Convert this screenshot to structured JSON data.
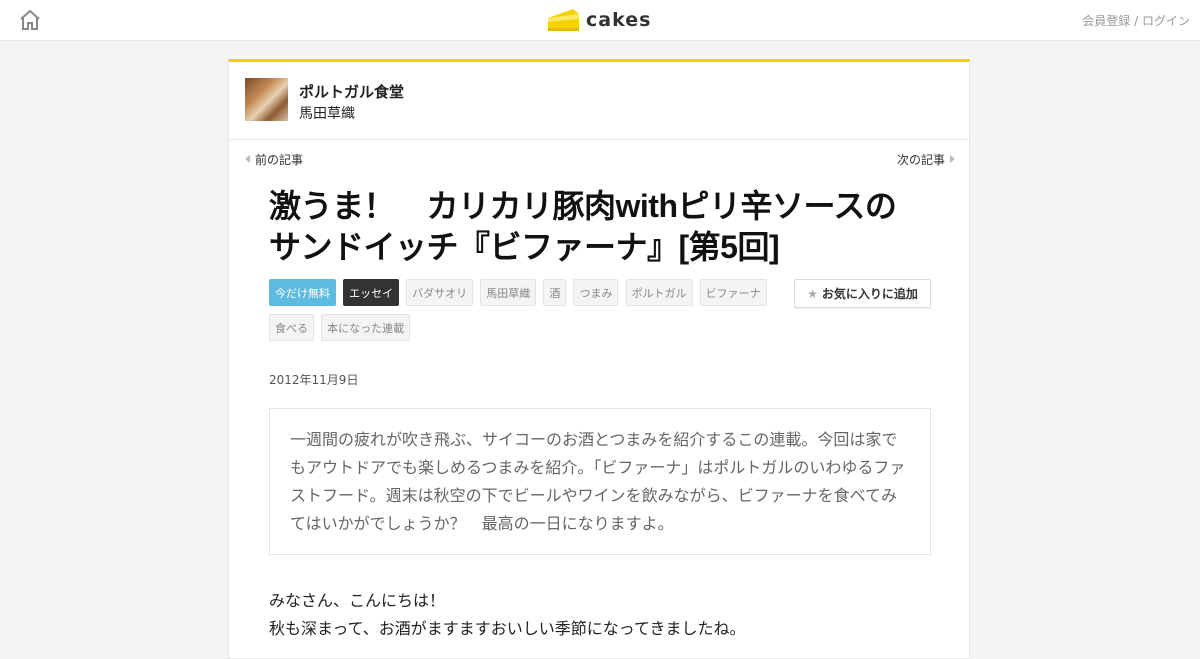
{
  "header": {
    "home_icon": "home-icon",
    "logo_text": "cakes",
    "logo_color": "#f5d200",
    "register_label": "会員登録",
    "separator": " / ",
    "login_label": "ログイン"
  },
  "series": {
    "title": "ポルトガル食堂",
    "author": "馬田草織"
  },
  "nav": {
    "prev_label": "前の記事",
    "next_label": "次の記事"
  },
  "article": {
    "title_line1": "激うま！　カリカリ豚肉withピリ辛ソースの",
    "title_line2": "サンドイッチ『ビファーナ』[第5回]",
    "tags": [
      "今だけ無料",
      "エッセイ",
      "バダサオリ",
      "馬田草織",
      "酒",
      "つまみ",
      "ポルトガル",
      "ビファーナ",
      "食べる",
      "本になった連載"
    ],
    "favorite_label": "お気に入りに追加",
    "date": "2012年11月9日",
    "lead": "一週間の疲れが吹き飛ぶ、サイコーのお酒とつまみを紹介するこの連載。今回は家でもアウトドアでも楽しめるつまみを紹介。「ビファーナ」はポルトガルのいわゆるファストフード。週末は秋空の下でビールやワインを飲みながら、ビファーナを食べてみてはいかがでしょうか？　最高の一日になりますよ。",
    "body_line1": "みなさん、こんにちは！",
    "body_line2": "秋も深まって、お酒がますますおいしい季節になってきましたね。"
  },
  "colors": {
    "accent": "#f5d200",
    "free_tag": "#5dbbe0",
    "essay_tag": "#333333"
  }
}
